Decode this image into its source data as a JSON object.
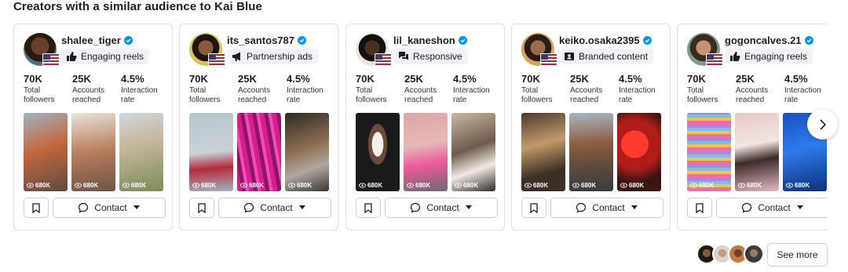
{
  "heading": "Creators with a similar audience to Kai Blue",
  "colors": {
    "verified": "#0095f6",
    "card_border": "#dcdfe3",
    "tag_bg": "#f0f2f5"
  },
  "creators": [
    {
      "handle": "shalee_tiger",
      "tag": "Engaging reels",
      "tag_icon": "thumbs-up-icon",
      "stats": [
        {
          "value": "70K",
          "label": "Total followers"
        },
        {
          "value": "25K",
          "label": "Accounts reached"
        },
        {
          "value": "4.5%",
          "label": "Interaction rate"
        }
      ],
      "media_views": [
        "680K",
        "680K",
        "680K"
      ],
      "contact_label": "Contact"
    },
    {
      "handle": "its_santos787",
      "tag": "Partnership ads",
      "tag_icon": "megaphone-icon",
      "stats": [
        {
          "value": "70K",
          "label": "Total followers"
        },
        {
          "value": "25K",
          "label": "Accounts reached"
        },
        {
          "value": "4.5%",
          "label": "Interaction rate"
        }
      ],
      "media_views": [
        "680K",
        "680K",
        "680K"
      ],
      "contact_label": "Contact"
    },
    {
      "handle": "lil_kaneshon",
      "tag": "Responsive",
      "tag_icon": "chat-bubbles-icon",
      "stats": [
        {
          "value": "70K",
          "label": "Total followers"
        },
        {
          "value": "25K",
          "label": "Accounts reached"
        },
        {
          "value": "4.5%",
          "label": "Interaction rate"
        }
      ],
      "media_views": [
        "680K",
        "680K",
        "680K"
      ],
      "contact_label": "Contact"
    },
    {
      "handle": "keiko.osaka2395",
      "tag": "Branded content",
      "tag_icon": "id-card-icon",
      "stats": [
        {
          "value": "70K",
          "label": "Total followers"
        },
        {
          "value": "25K",
          "label": "Accounts reached"
        },
        {
          "value": "4.5%",
          "label": "Interaction rate"
        }
      ],
      "media_views": [
        "680K",
        "680K",
        "680K"
      ],
      "contact_label": "Contact"
    },
    {
      "handle": "gogoncalves.21",
      "tag": "Engaging reels",
      "tag_icon": "thumbs-up-icon",
      "stats": [
        {
          "value": "70K",
          "label": "Total followers"
        },
        {
          "value": "25K",
          "label": "Accounts reached"
        },
        {
          "value": "4.5%",
          "label": "Interaction rate"
        }
      ],
      "media_views": [
        "680K",
        "680K",
        "680K"
      ],
      "contact_label": "Contact"
    }
  ],
  "see_more_label": "See more"
}
